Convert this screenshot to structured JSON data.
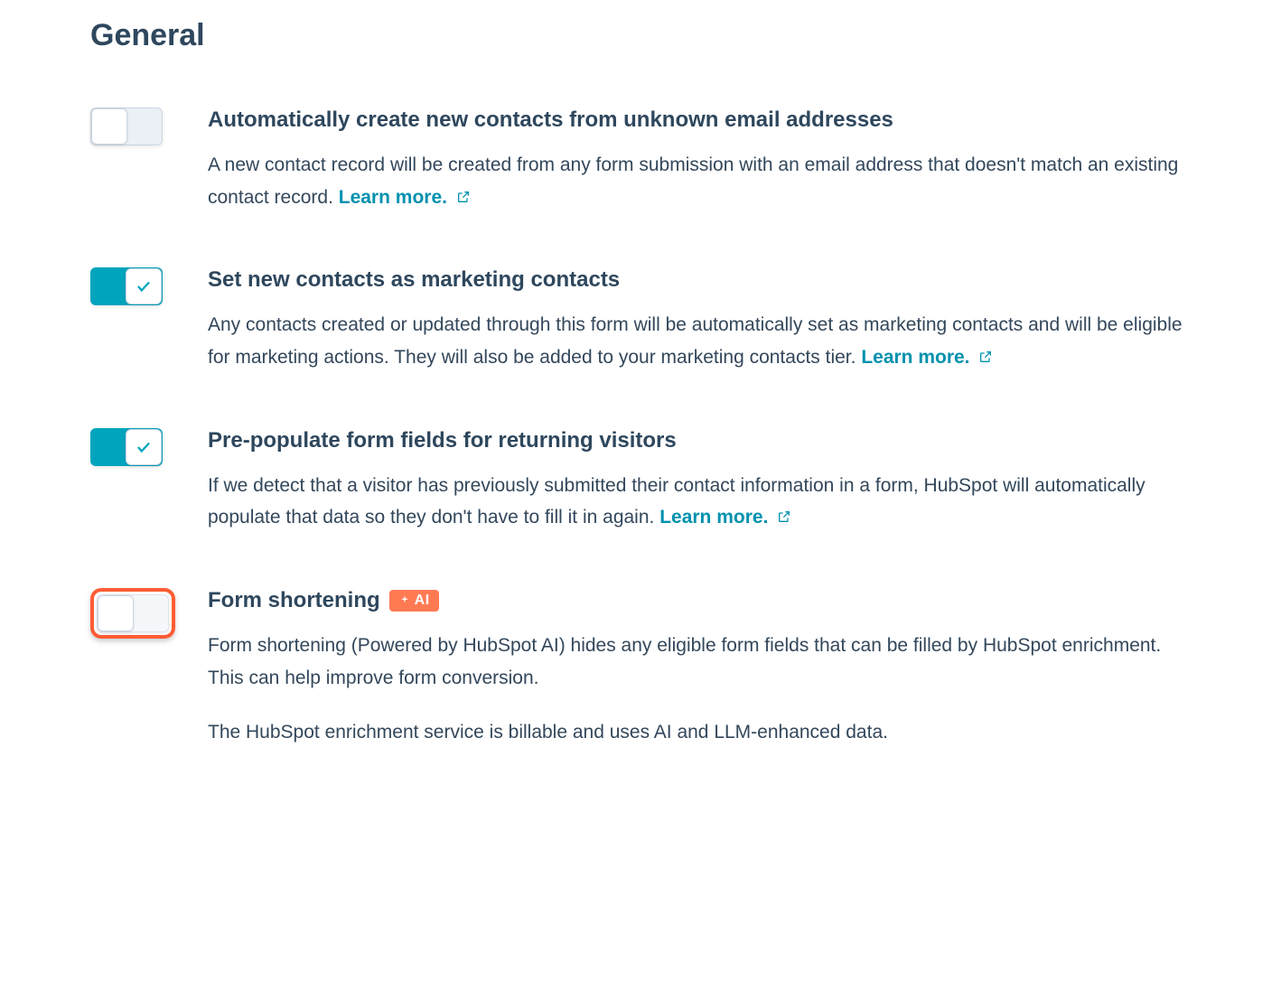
{
  "section_title": "General",
  "settings": [
    {
      "title": "Automatically create new contacts from unknown email addresses",
      "description": "A new contact record will be created from any form submission with an email address that doesn't match an existing contact record.",
      "learn_more": "Learn more.",
      "toggle_state": "off",
      "highlighted": false
    },
    {
      "title": "Set new contacts as marketing contacts",
      "description": "Any contacts created or updated through this form will be automatically set as marketing contacts and will be eligible for marketing actions. They will also be added to your marketing contacts tier.",
      "learn_more": "Learn more.",
      "toggle_state": "on",
      "highlighted": false
    },
    {
      "title": "Pre-populate form fields for returning visitors",
      "description": "If we detect that a visitor has previously submitted their contact information in a form, HubSpot will automatically populate that data so they don't have to fill it in again.",
      "learn_more": "Learn more.",
      "toggle_state": "on",
      "highlighted": false
    },
    {
      "title": "Form shortening",
      "badge": "AI",
      "description": "Form shortening (Powered by HubSpot AI) hides any eligible form fields that can be filled by HubSpot enrichment. This can help improve form conversion.",
      "description2": "The HubSpot enrichment service is billable and uses AI and LLM-enhanced data.",
      "toggle_state": "off",
      "highlighted": true
    }
  ]
}
